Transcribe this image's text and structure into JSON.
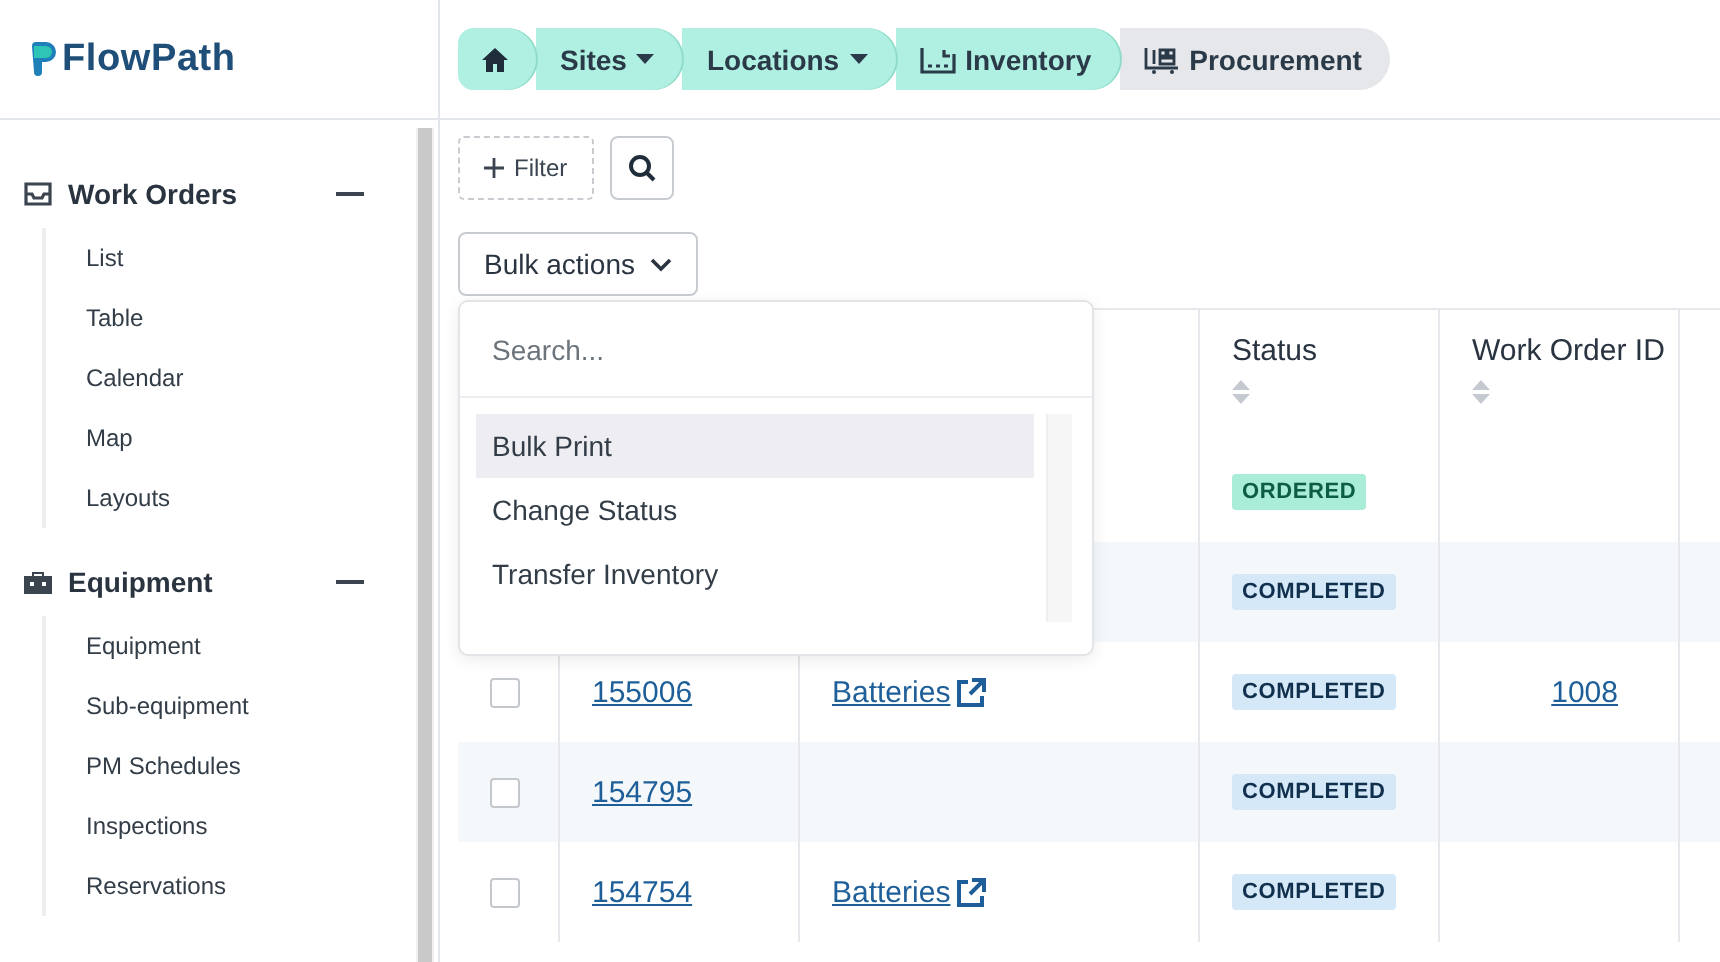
{
  "logo": {
    "text": "FlowPath"
  },
  "breadcrumb": [
    {
      "kind": "home",
      "highlighted": true
    },
    {
      "kind": "menu",
      "label": "Sites",
      "highlighted": true
    },
    {
      "kind": "menu",
      "label": "Locations",
      "highlighted": true
    },
    {
      "kind": "inventory",
      "label": "Inventory",
      "highlighted": true
    },
    {
      "kind": "procurement",
      "label": "Procurement",
      "highlighted": false
    }
  ],
  "sidebar": {
    "sections": [
      {
        "kind": "inbox",
        "title": "Work Orders",
        "expanded": true,
        "items": [
          "List",
          "Table",
          "Calendar",
          "Map",
          "Layouts"
        ]
      },
      {
        "kind": "toolbox",
        "title": "Equipment",
        "expanded": true,
        "items": [
          "Equipment",
          "Sub-equipment",
          "PM Schedules",
          "Inspections",
          "Reservations"
        ]
      }
    ]
  },
  "toolbar": {
    "filter_label": "Filter",
    "bulk_actions_label": "Bulk actions"
  },
  "bulk_menu": {
    "search_placeholder": "Search...",
    "items": [
      {
        "label": "Bulk Print",
        "selected": true
      },
      {
        "label": "Change Status",
        "selected": false
      },
      {
        "label": "Transfer Inventory",
        "selected": false
      }
    ]
  },
  "table": {
    "columns": [
      {
        "kind": "check"
      },
      {
        "kind": "plain"
      },
      {
        "kind": "plain"
      },
      {
        "kind": "sortable",
        "label": "Status"
      },
      {
        "kind": "sortable",
        "label": "Work Order ID"
      },
      {
        "kind": "plain"
      }
    ],
    "rows": [
      {
        "status": "ORDERED",
        "color": "#a9ecd8"
      },
      {
        "status": "COMPLETED",
        "color": "#d4e8f8"
      },
      {
        "checked": false,
        "id": "155006",
        "part": "Batteries",
        "status": "COMPLETED",
        "color": "#d4e8f8",
        "work_order": "1008"
      },
      {
        "checked": false,
        "id": "154795",
        "status": "COMPLETED",
        "color": "#d4e8f8"
      },
      {
        "checked": false,
        "id": "154754",
        "part": "Batteries",
        "status": "COMPLETED",
        "color": "#d4e8f8"
      }
    ]
  }
}
